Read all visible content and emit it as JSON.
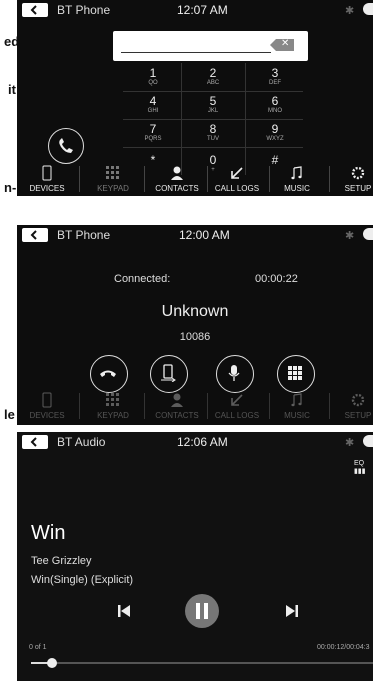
{
  "edge_text": {
    "t1": "ed",
    "t2": "it",
    "t3": "n-",
    "t4": "le"
  },
  "screen1": {
    "title": "BT Phone",
    "time": "12:07 AM",
    "keys": [
      {
        "d": "1",
        "l": "QO"
      },
      {
        "d": "2",
        "l": "ABC"
      },
      {
        "d": "3",
        "l": "DEF"
      },
      {
        "d": "4",
        "l": "GHI"
      },
      {
        "d": "5",
        "l": "JKL"
      },
      {
        "d": "6",
        "l": "MNO"
      },
      {
        "d": "7",
        "l": "PQRS"
      },
      {
        "d": "8",
        "l": "TUV"
      },
      {
        "d": "9",
        "l": "WXYZ"
      },
      {
        "d": "*",
        "l": ""
      },
      {
        "d": "0",
        "l": "+"
      },
      {
        "d": "#",
        "l": ""
      }
    ],
    "nav": [
      "DEVICES",
      "KEYPAD",
      "CONTACTS",
      "CALL LOGS",
      "MUSIC",
      "SETUP"
    ]
  },
  "screen2": {
    "title": "BT Phone",
    "time": "12:00 AM",
    "status": "Connected:",
    "duration": "00:00:22",
    "caller": "Unknown",
    "number": "10086",
    "nav": [
      "DEVICES",
      "KEYPAD",
      "CONTACTS",
      "CALL LOGS",
      "MUSIC",
      "SETUP"
    ]
  },
  "screen3": {
    "title": "BT Audio",
    "time": "12:06 AM",
    "eq": "EQ",
    "song": "Win",
    "artist": "Tee Grizzley",
    "album": "Win(Single) (Explicit)",
    "track": "0 of 1",
    "elapsed": "00:00:12/00:04:3",
    "progress": 0.06
  }
}
